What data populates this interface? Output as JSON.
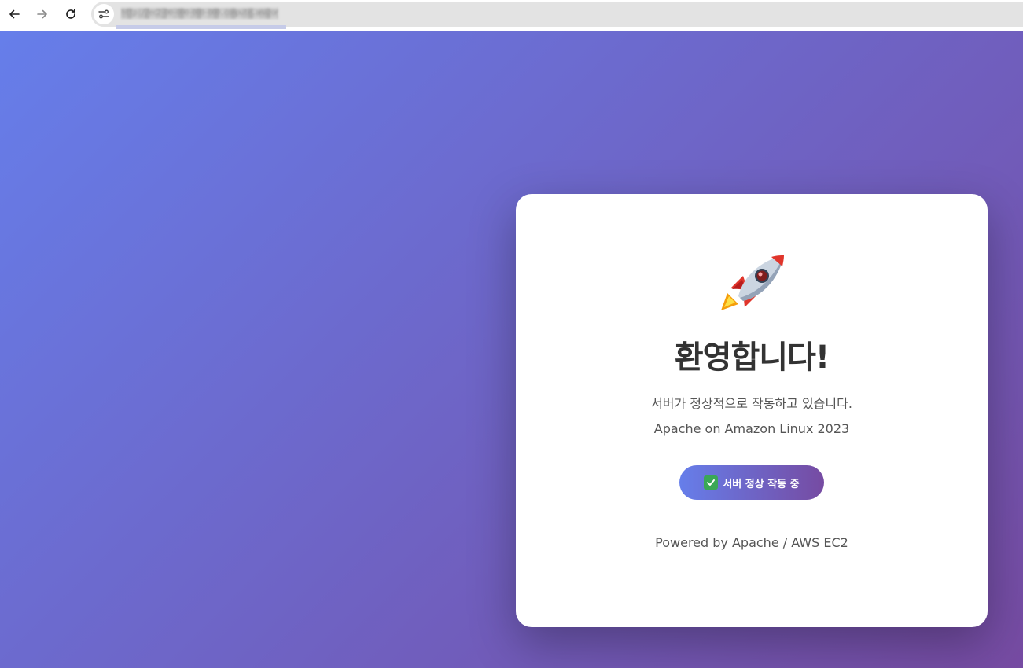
{
  "browser": {
    "url": "http://ec2-00-000-000-000.compute.amazonaws.com",
    "icons": {
      "back": "arrow-left-icon",
      "forward": "arrow-right-icon",
      "reload": "reload-icon",
      "site_info": "tune-icon"
    }
  },
  "page": {
    "emoji_icon": "rocket-icon",
    "title": "환영합니다!",
    "status_text": "서버가 정상적으로 작동하고 있습니다.",
    "server_info": "Apache on Amazon Linux 2023",
    "badge": {
      "icon": "check-mark-icon",
      "label": "서버 정상 작동 중"
    },
    "footer": "Powered by Apache / AWS EC2"
  },
  "colors": {
    "gradient_start": "#667eea",
    "gradient_end": "#764ba2",
    "card_bg": "#ffffff",
    "heading": "#333333",
    "body_text": "#555555"
  }
}
